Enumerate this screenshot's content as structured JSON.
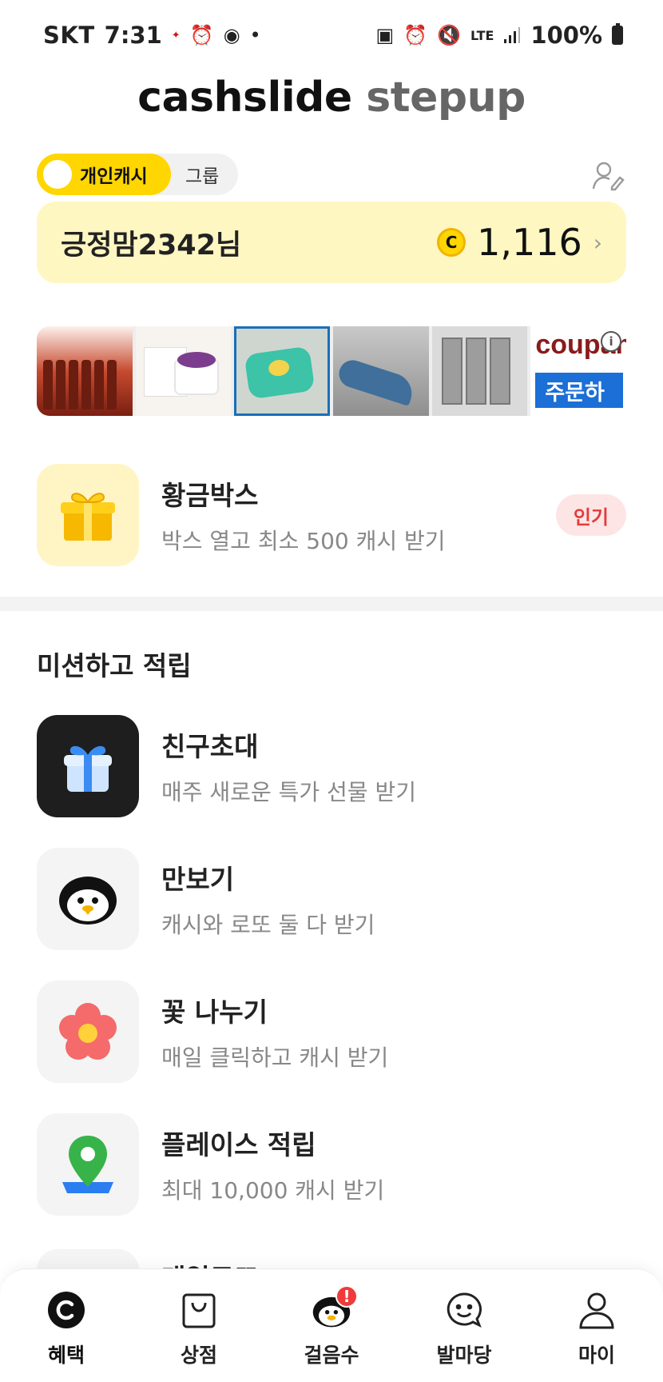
{
  "status_bar": {
    "carrier": "SKT",
    "time": "7:31",
    "network": "LTE",
    "battery": "100%"
  },
  "brand": {
    "part1": "cashslide",
    "part2": "stepup"
  },
  "toggle": {
    "active": "개인캐시",
    "inactive": "그룹"
  },
  "balance": {
    "user": "긍정맘2342님",
    "coin_symbol": "C",
    "amount": "1,116"
  },
  "ad": {
    "brand": "coupan",
    "cta": "주문하",
    "info": "i"
  },
  "golden_box": {
    "title": "황금박스",
    "subtitle": "박스 열고 최소 500 캐시 받기",
    "badge": "인기"
  },
  "missions": {
    "title": "미션하고 적립",
    "items": [
      {
        "title": "친구초대",
        "subtitle": "매주 새로운 특가 선물 받기",
        "icon": "gift-icon"
      },
      {
        "title": "만보기",
        "subtitle": "캐시와 로또 둘 다 받기",
        "icon": "penguin-icon"
      },
      {
        "title": "꽃 나누기",
        "subtitle": "매일 클릭하고 캐시 받기",
        "icon": "flower-icon"
      },
      {
        "title": "플레이스 적립",
        "subtitle": "최대 10,000 캐시 받기",
        "icon": "map-pin-icon"
      },
      {
        "title": "매일로또",
        "subtitle": "",
        "icon": "lotto-icon"
      }
    ]
  },
  "nav": {
    "items": [
      {
        "label": "혜택",
        "icon": "cash-c-icon",
        "active": true
      },
      {
        "label": "상점",
        "icon": "shopping-bag-icon",
        "active": false
      },
      {
        "label": "걸음수",
        "icon": "penguin-icon",
        "active": false,
        "alert": "!"
      },
      {
        "label": "발마당",
        "icon": "smile-chat-icon",
        "active": false
      },
      {
        "label": "마이",
        "icon": "person-icon",
        "active": false
      }
    ]
  },
  "colors": {
    "accent": "#ffd600",
    "balance_bg": "#fff7c2",
    "hot_badge_bg": "#fde5e5",
    "hot_badge_text": "#e23c3c"
  }
}
